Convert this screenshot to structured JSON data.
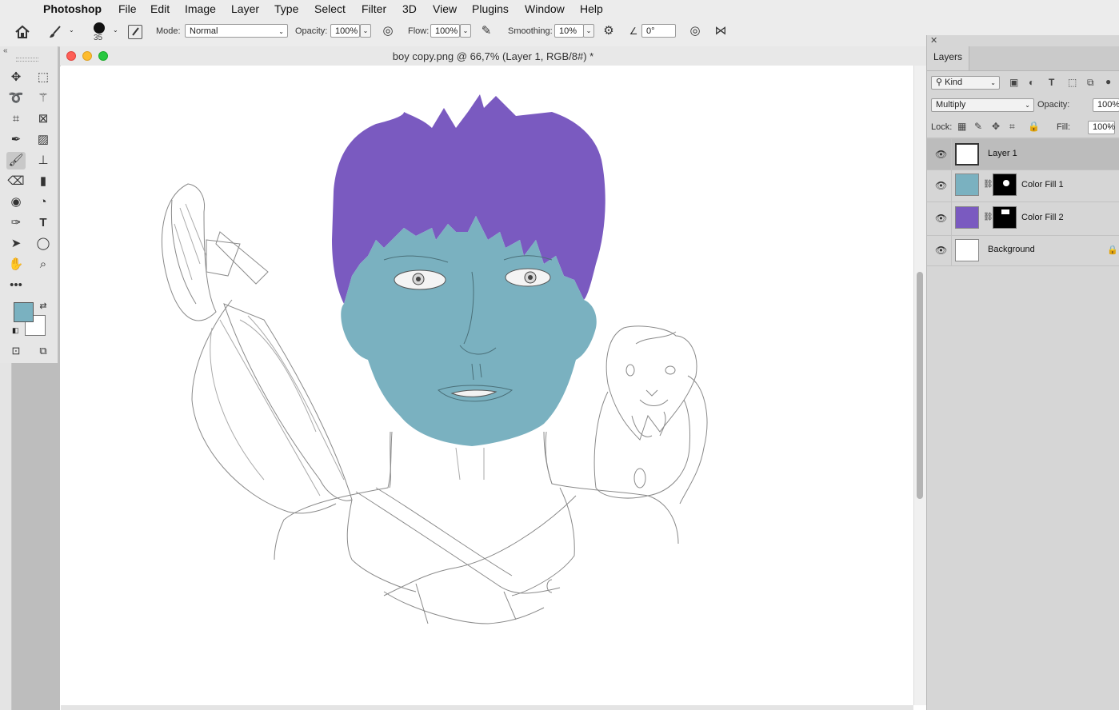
{
  "menubar": {
    "app": "Photoshop",
    "items": [
      "File",
      "Edit",
      "Image",
      "Layer",
      "Type",
      "Select",
      "Filter",
      "3D",
      "View",
      "Plugins",
      "Window",
      "Help"
    ]
  },
  "options": {
    "brush_size": "35",
    "mode_label": "Mode:",
    "mode_value": "Normal",
    "opacity_label": "Opacity:",
    "opacity_value": "100%",
    "flow_label": "Flow:",
    "flow_value": "100%",
    "smoothing_label": "Smoothing:",
    "smoothing_value": "10%",
    "angle_value": "0°"
  },
  "tools": {
    "foreground_color": "#7ab1c0",
    "background_color": "#ffffff"
  },
  "document": {
    "title": "boy copy.png @ 66,7% (Layer 1, RGB/8#) *"
  },
  "layers_panel": {
    "tab": "Layers",
    "filter_kind": "Kind",
    "blend_mode": "Multiply",
    "opacity_label": "Opacity:",
    "opacity_value": "100%",
    "lock_label": "Lock:",
    "fill_label": "Fill:",
    "fill_value": "100%",
    "layers": [
      {
        "name": "Layer 1",
        "selected": true
      },
      {
        "name": "Color Fill 1",
        "color": "#7ab1c0"
      },
      {
        "name": "Color Fill 2",
        "color": "#7a5ac0"
      },
      {
        "name": "Background",
        "locked": true
      }
    ]
  },
  "colors": {
    "skin": "#7ab1c0",
    "hair": "#7a5ac0"
  }
}
